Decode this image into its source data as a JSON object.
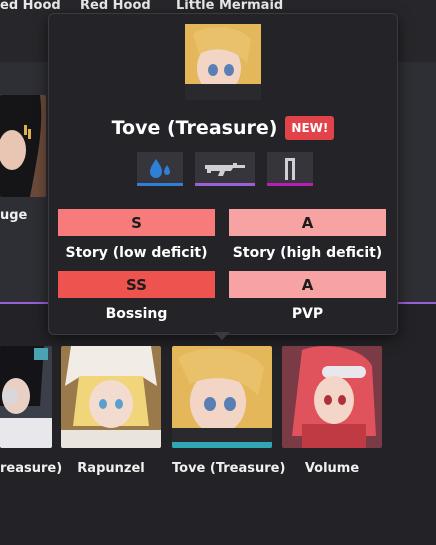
{
  "top_row": {
    "names": [
      "ed Hood",
      "Red Hood",
      "Little Mermaid"
    ]
  },
  "left_partial": {
    "name": "uge"
  },
  "popup": {
    "title": "Tove (Treasure)",
    "badge": "NEW!",
    "icons": [
      {
        "name": "water-element-icon",
        "bar_color": "#2f7fd6"
      },
      {
        "name": "assault-rifle-icon",
        "bar_color": "#9b5fd6"
      },
      {
        "name": "burst-icon",
        "bar_color": "#b71fb5"
      }
    ],
    "ratings": [
      {
        "grade": "S",
        "label": "Story (low deficit)",
        "color": "#f77b7b"
      },
      {
        "grade": "A",
        "label": "Story (high deficit)",
        "color": "#f7a3a3"
      },
      {
        "grade": "SS",
        "label": "Bossing",
        "color": "#ef534f"
      },
      {
        "grade": "A",
        "label": "PVP",
        "color": "#f7a3a3"
      }
    ]
  },
  "bottom_row": {
    "cards": [
      {
        "name": "reasure)"
      },
      {
        "name": "Rapunzel"
      },
      {
        "name": "Tove (Treasure)"
      },
      {
        "name": "Volume"
      }
    ]
  }
}
